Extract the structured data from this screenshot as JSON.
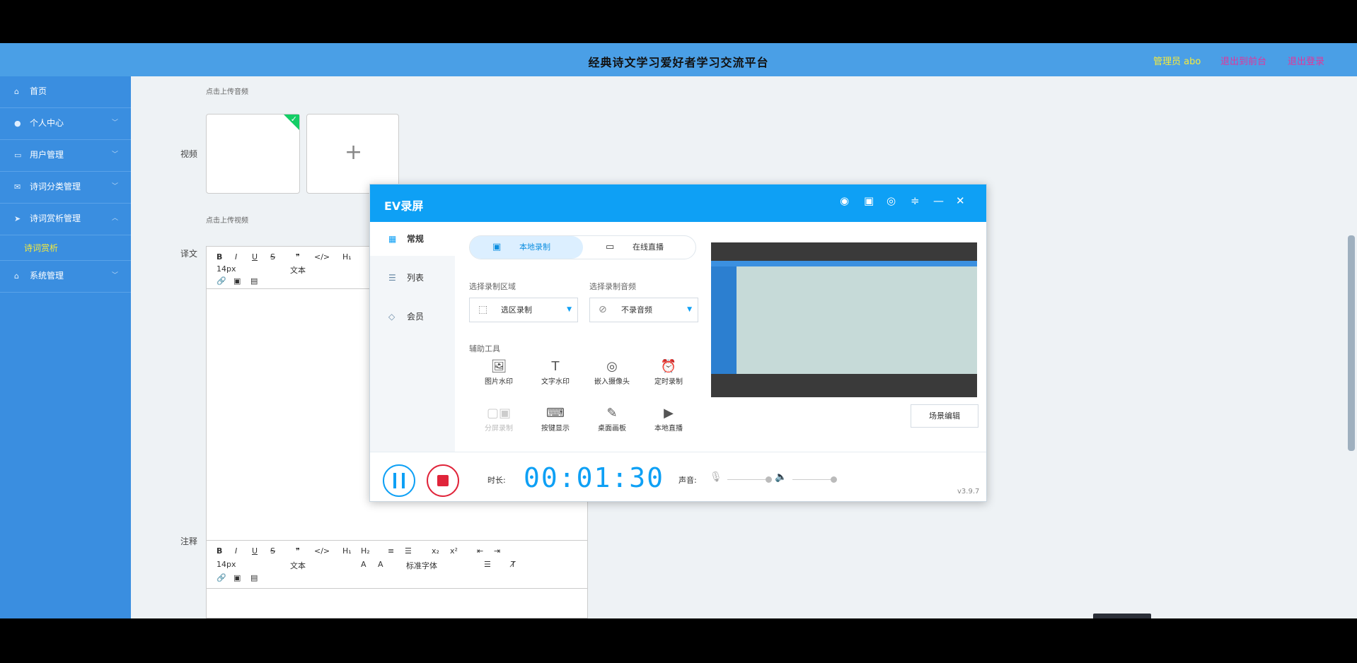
{
  "header": {
    "title": "经典诗文学习爱好者学习交流平台",
    "admin": "管理员 abo",
    "link_front": "退出到前台",
    "link_logout": "退出登录"
  },
  "sidebar": {
    "items": [
      {
        "label": "首页",
        "icon": "home-icon"
      },
      {
        "label": "个人中心",
        "icon": "user-icon"
      },
      {
        "label": "用户管理",
        "icon": "folder-icon"
      },
      {
        "label": "诗词分类管理",
        "icon": "mail-icon"
      },
      {
        "label": "诗词赏析管理",
        "icon": "send-icon"
      },
      {
        "label": "系统管理",
        "icon": "home-icon"
      }
    ],
    "sub_item": "诗词赏析"
  },
  "form": {
    "audio_hint": "点击上传音频",
    "video_label": "视频",
    "video_hint": "点击上传视频",
    "translation_label": "译文",
    "notes_label": "注释",
    "font_size": "14px",
    "text_style": "文本",
    "font_family": "标准字体"
  },
  "ev": {
    "title": "EV录屏",
    "tabs": [
      "常规",
      "列表",
      "会员"
    ],
    "mode_local": "本地录制",
    "mode_live": "在线直播",
    "area_label": "选择录制区域",
    "area_value": "选区录制",
    "audio_label": "选择录制音频",
    "audio_value": "不录音频",
    "tools_label": "辅助工具",
    "tools": [
      "图片水印",
      "文字水印",
      "嵌入摄像头",
      "定时录制",
      "分屏录制",
      "按键显示",
      "桌面画板",
      "本地直播"
    ],
    "scene_button": "场景编辑",
    "duration_label": "时长:",
    "timer": "00:01:30",
    "sound_label": "声音:",
    "version": "v3.9.7"
  }
}
